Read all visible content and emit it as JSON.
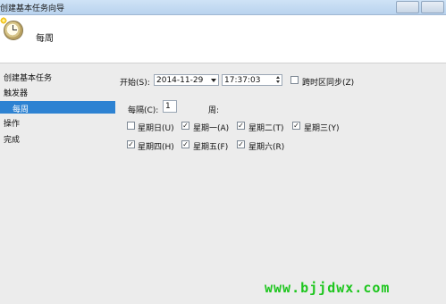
{
  "window": {
    "title": "创建基本任务向导"
  },
  "header": {
    "title": "每周"
  },
  "sidebar": {
    "items": [
      {
        "label": "创建基本任务"
      },
      {
        "label": "触发器"
      },
      {
        "label": "每周",
        "selected": true
      },
      {
        "label": "操作"
      },
      {
        "label": "完成"
      }
    ]
  },
  "start": {
    "label": "开始(S):",
    "date": "2014-11-29",
    "time": "17:37:03",
    "sync_label": "跨时区同步(Z)",
    "sync_checked": false
  },
  "recur": {
    "label": "每隔(C):",
    "value": "1",
    "unit": "周:"
  },
  "days": [
    {
      "label": "星期日(U)",
      "checked": false
    },
    {
      "label": "星期一(A)",
      "checked": true
    },
    {
      "label": "星期二(T)",
      "checked": true
    },
    {
      "label": "星期三(Y)",
      "checked": true
    },
    {
      "label": "星期四(H)",
      "checked": true
    },
    {
      "label": "星期五(F)",
      "checked": true
    },
    {
      "label": "星期六(R)",
      "checked": true
    }
  ],
  "watermark": "www.bjjdwx.com",
  "colors": {
    "selection": "#2d82d2",
    "watermark": "#1ec61e"
  }
}
